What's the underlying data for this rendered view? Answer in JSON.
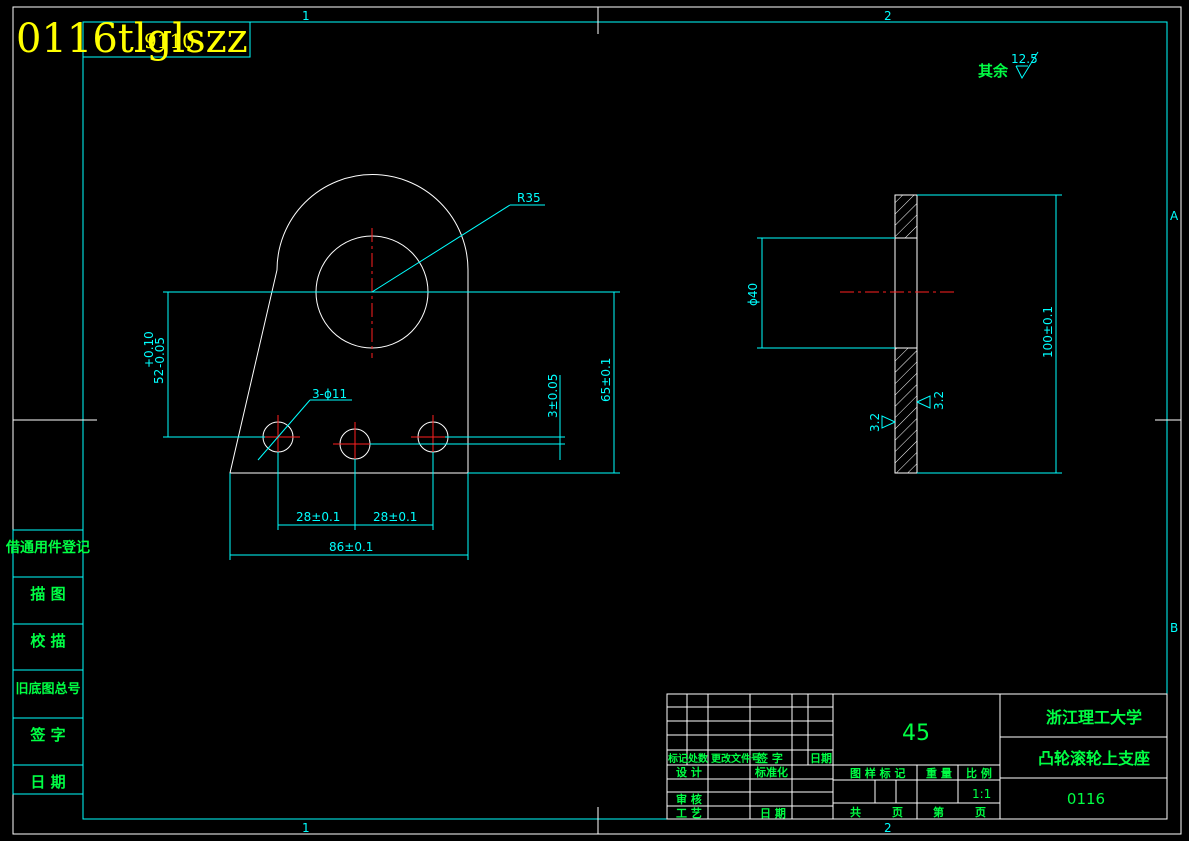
{
  "watermark": "0116tlglszz",
  "drawing_code": "9110",
  "zone_top": [
    "1",
    "2"
  ],
  "zone_side": [
    "A",
    "B"
  ],
  "roughness_rest": {
    "label": "其余",
    "value": "12.5"
  },
  "front_view": {
    "radius": "R35",
    "holes": "3-ϕ11",
    "dim_52": "52",
    "tol_upper": "+0.10",
    "tol_lower": "-0.05",
    "dim_65": "65±0.1",
    "dim_3": "3±0.05",
    "dim_28a": "28±0.1",
    "dim_28b": "28±0.1",
    "dim_86": "86±0.1"
  },
  "side_view": {
    "dia": "ϕ40",
    "height": "100±0.1",
    "rough_left": "3.2",
    "rough_right": "3.2"
  },
  "side_table": [
    "借通用件登记",
    "描 图",
    "校 描",
    "旧底图总号",
    "签 字",
    "日 期"
  ],
  "title_block": {
    "material": "45",
    "school": "浙江理工大学",
    "part_name": "凸轮滚轮上支座",
    "drawing_no": "0116",
    "scale": "1:1",
    "headers": {
      "mark": "标记",
      "count": "处数",
      "change_doc": "更改文件号",
      "sign": "签 字",
      "date": "日期",
      "design": "设 计",
      "standard": "标准化",
      "review": "审 核",
      "process": "工 艺",
      "date2": "日 期",
      "stage_mark": "图 样 标 记",
      "weight": "重 量",
      "ratio": "比 例",
      "total": "共",
      "page": "页",
      "page_no": "第",
      "page2": "页"
    }
  }
}
